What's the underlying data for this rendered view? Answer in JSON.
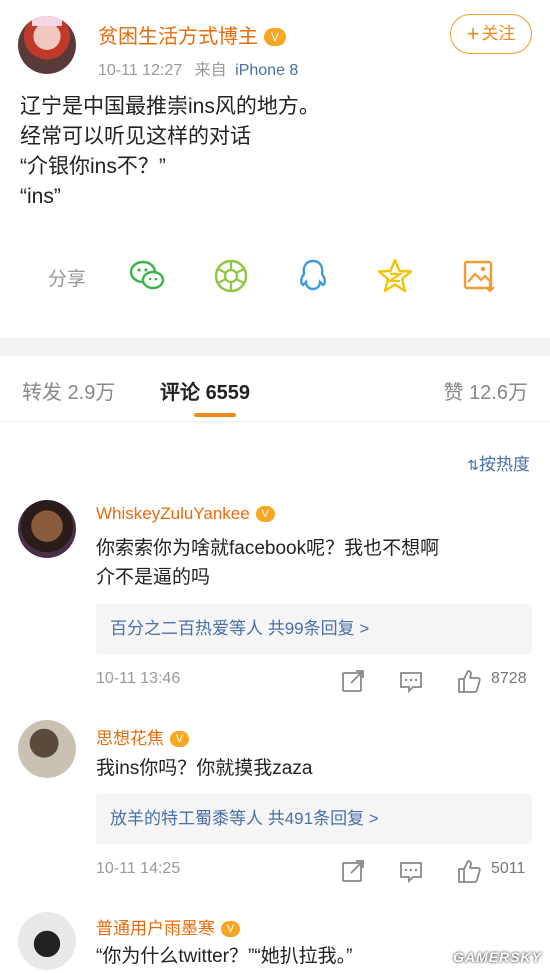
{
  "post": {
    "author": "贫困生活方式博主",
    "time": "10-11 12:27",
    "source_prefix": "来自",
    "device": "iPhone 8",
    "follow_label": "关注",
    "lines": [
      "辽宁是中国最推崇ins风的地方。",
      "经常可以听见这样的对话",
      "“介银你ins不？”",
      "“ins”"
    ],
    "share_label": "分享",
    "share_icons": [
      "wechat-icon",
      "moments-icon",
      "qq-icon",
      "qzone-icon",
      "save-image-icon"
    ]
  },
  "tabs": {
    "repost_label": "转发",
    "repost_count": "2.9万",
    "comment_label": "评论",
    "comment_count": "6559",
    "like_label": "赞",
    "like_count": "12.6万"
  },
  "sort_label": "按热度",
  "comments": [
    {
      "name": "WhiskeyZuluYankee",
      "text_lines": [
        "你索索你为啥就facebook呢？我也不想啊",
        "介不是逼的吗"
      ],
      "reply_summary": "百分之二百热爱等人 共99条回复 >",
      "time": "10-11 13:46",
      "likes": "8728"
    },
    {
      "name": "思想花焦",
      "text_lines": [
        "我ins你吗？你就摸我zaza"
      ],
      "reply_summary": "放羊的特工蜀黍等人 共491条回复 >",
      "time": "10-11 14:25",
      "likes": "5011"
    },
    {
      "name": "普通用户雨墨寒",
      "text_lines": [
        "“你为什么twitter？”“她扒拉我。”"
      ]
    }
  ],
  "watermark": "GAMERSKY",
  "colors": {
    "accent": "#f08a1d",
    "link": "#4a6fa5",
    "name": "#e86b0c"
  }
}
